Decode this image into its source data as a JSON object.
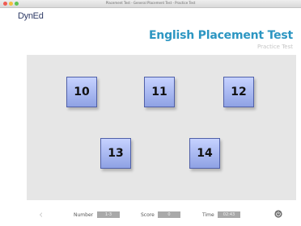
{
  "window": {
    "title": "Placement Test - General Placement Test - Practice Test"
  },
  "brand": {
    "logo": "DynEd"
  },
  "header": {
    "title": "English Placement Test",
    "subtitle": "Practice Test"
  },
  "tiles": [
    {
      "label": "10"
    },
    {
      "label": "11"
    },
    {
      "label": "12"
    },
    {
      "label": "13"
    },
    {
      "label": "14"
    }
  ],
  "footer": {
    "back_icon": "chevron-left-icon",
    "number_label": "Number",
    "number_value": "1-3",
    "score_label": "Score",
    "score_value": "0",
    "time_label": "Time",
    "time_value": "02:43",
    "power_icon": "power-icon"
  },
  "colors": {
    "accent": "#2c96c2",
    "tile_top": "#c6d2ff",
    "tile_bottom": "#8fa2e4",
    "panel": "#e6e6e6"
  }
}
